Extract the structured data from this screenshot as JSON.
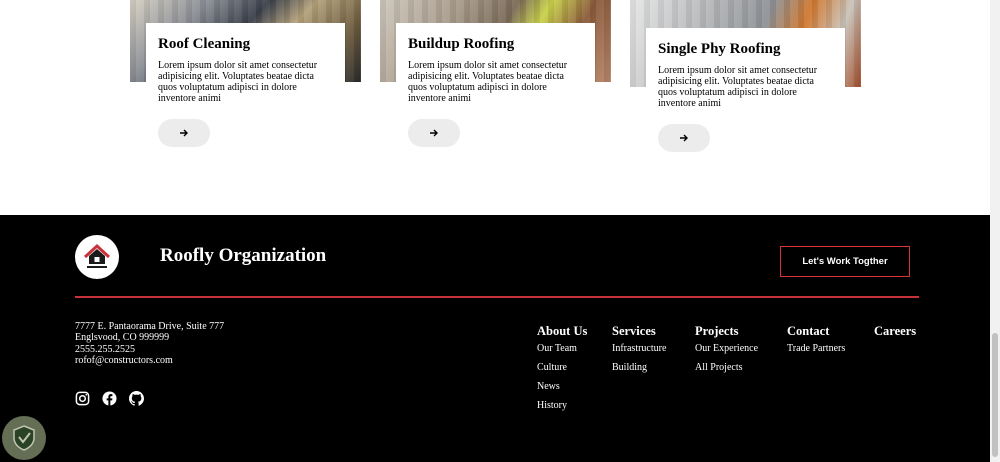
{
  "services": {
    "cards": [
      {
        "title": "Roof Cleaning",
        "description": "Lorem ipsum dolor sit amet consectetur adipisicing elit. Voluptates beatae dicta quos voluptatum adipisci in dolore inventore animi",
        "icon": "arrow-right-icon"
      },
      {
        "title": "Buildup Roofing",
        "description": "Lorem ipsum dolor sit amet consectetur adipisicing elit. Voluptates beatae dicta quos voluptatum adipisci in dolore inventore animi",
        "icon": "arrow-right-icon"
      },
      {
        "title": "Single Phy Roofing",
        "description": "Lorem ipsum dolor sit amet consectetur adipisicing elit. Voluptates beatae dicta quos voluptatum adipisci in dolore inventore animi",
        "icon": "arrow-right-icon"
      }
    ]
  },
  "footer": {
    "org_name": "Roofly Organization",
    "cta_label": "Let's Work Togther",
    "address": {
      "line1": "7777 E. Pantaorama Drive, Suite 777",
      "line2": "Englsvood, CO 999999",
      "phone": "2555.255.2525",
      "email": "rofof@constructors.com"
    },
    "social_icons": [
      "instagram-icon",
      "facebook-icon",
      "github-icon"
    ],
    "columns": [
      {
        "heading": "About Us",
        "links": [
          "Our Team",
          "Culture",
          "News",
          "History"
        ]
      },
      {
        "heading": "Services",
        "links": [
          "Infrastructure",
          "Building"
        ]
      },
      {
        "heading": "Projects",
        "links": [
          "Our Experience",
          "All Projects"
        ]
      },
      {
        "heading": "Contact",
        "links": [
          "Trade Partners"
        ]
      },
      {
        "heading": "Careers",
        "links": []
      }
    ],
    "colors": {
      "background": "#000000",
      "accent": "#c9313a",
      "text": "#ffffff"
    }
  }
}
